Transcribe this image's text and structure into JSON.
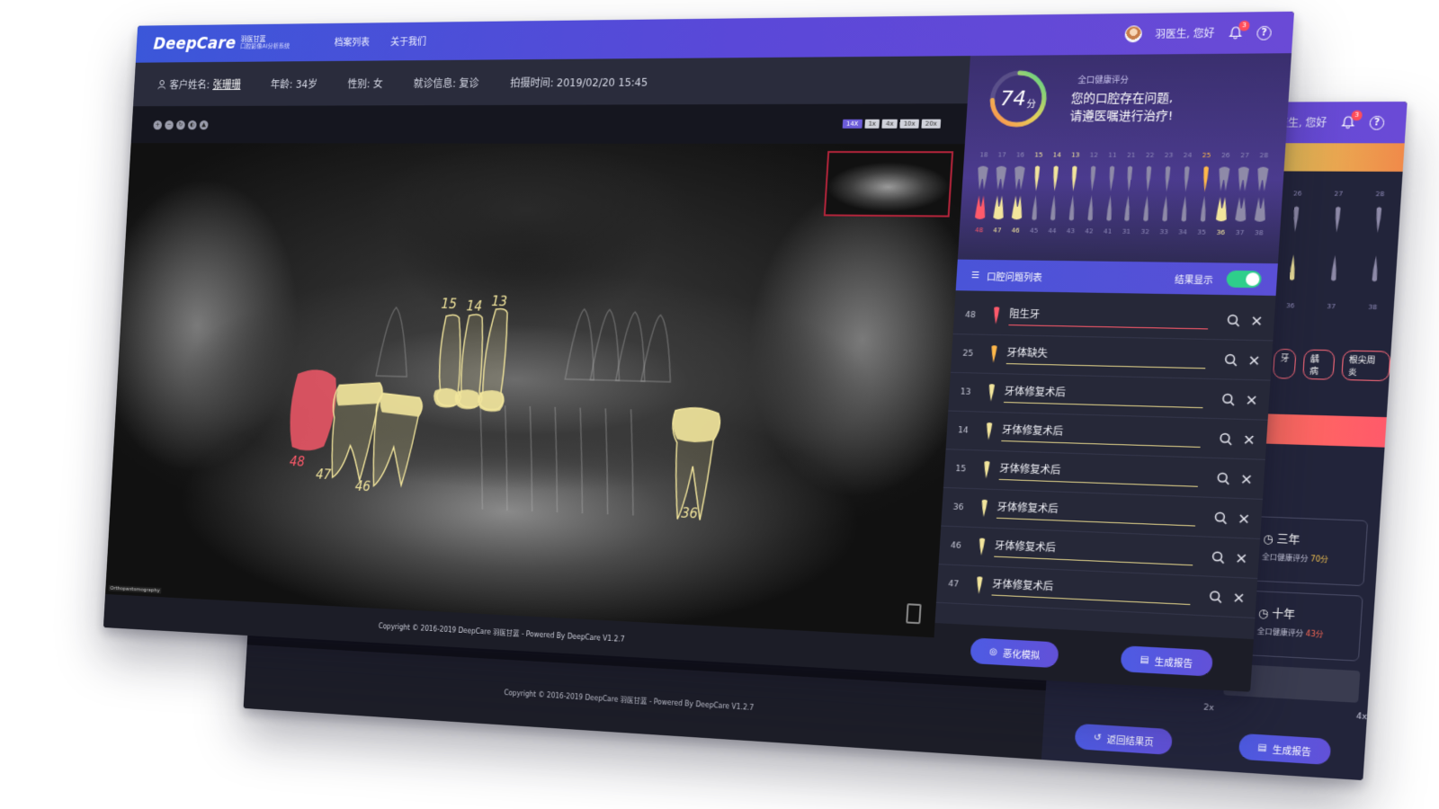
{
  "app": {
    "brand": "DeepCare",
    "brand_sub_1": "羽医甘蓝",
    "brand_sub_2": "口腔影像AI分析系统",
    "nav": [
      "档案列表",
      "关于我们"
    ],
    "greeting": "羽医生, 您好",
    "bell_count": "3",
    "help_glyph": "?"
  },
  "patient": {
    "name_label": "客户姓名:",
    "name": "张珊珊",
    "age": "年龄: 34岁",
    "gender": "性别: 女",
    "visit": "就诊信息: 复诊",
    "time": "拍摄时间: 2019/02/20 15:45"
  },
  "viewer": {
    "tool_icons": [
      "zoom-in-icon",
      "zoom-out-icon",
      "rotate-icon",
      "contrast-icon",
      "brightness-icon"
    ],
    "zoom_levels": [
      "14X",
      "1x",
      "4x",
      "10x",
      "20x"
    ],
    "active_zoom": "14X",
    "film_label": "Orthopantomography",
    "tooth_labels": [
      "15",
      "14",
      "13",
      "48",
      "47",
      "46",
      "36"
    ]
  },
  "footer": {
    "copyright": "Copyright © 2016-2019 DeepCare 羽医甘蓝 - Powered By DeepCare V1.2.7"
  },
  "health": {
    "score": "74",
    "unit": "分",
    "score_fraction": 0.74,
    "title": "全口健康评分",
    "message_1": "您的口腔存在问题,",
    "message_2": "请遵医嘱进行治疗!",
    "upper_teeth": [
      "18",
      "17",
      "16",
      "15",
      "14",
      "13",
      "12",
      "11",
      "21",
      "22",
      "23",
      "24",
      "25",
      "26",
      "27",
      "28"
    ],
    "lower_teeth": [
      "48",
      "47",
      "46",
      "45",
      "44",
      "43",
      "42",
      "41",
      "31",
      "32",
      "33",
      "34",
      "35",
      "36",
      "37",
      "38"
    ]
  },
  "issues": {
    "header": "口腔问题列表",
    "result_toggle_label": "结果显示",
    "toggle_on": true,
    "items": [
      {
        "tooth": "48",
        "label": "阻生牙",
        "severity": "red"
      },
      {
        "tooth": "25",
        "label": "牙体缺失",
        "severity": "orange"
      },
      {
        "tooth": "13",
        "label": "牙体修复术后",
        "severity": "yellow"
      },
      {
        "tooth": "14",
        "label": "牙体修复术后",
        "severity": "yellow"
      },
      {
        "tooth": "15",
        "label": "牙体修复术后",
        "severity": "yellow"
      },
      {
        "tooth": "36",
        "label": "牙体修复术后",
        "severity": "yellow"
      },
      {
        "tooth": "46",
        "label": "牙体修复术后",
        "severity": "yellow"
      },
      {
        "tooth": "47",
        "label": "牙体修复术后",
        "severity": "yellow"
      }
    ]
  },
  "actions": {
    "simulate": "恶化模拟",
    "report": "生成报告",
    "back": "返回结果页"
  },
  "back_screen": {
    "greeting": "羽医生, 您好",
    "bell_count": "3",
    "tags": [
      "牙",
      "龋病",
      "根尖周炎"
    ],
    "projections": [
      {
        "period": "三年",
        "label": "全口健康评分",
        "score": "70分"
      },
      {
        "period": "十年",
        "label": "全口健康评分",
        "score": "43分"
      }
    ],
    "speeds": [
      "2x",
      "4x"
    ],
    "lower_nums_visible": [
      "31",
      "32",
      "33",
      "34",
      "35",
      "36",
      "37",
      "38"
    ],
    "upper_nums_visible": [
      "21",
      "22",
      "23",
      "24",
      "25",
      "26",
      "27",
      "28"
    ]
  },
  "colors": {
    "header_start": "#3b57d9",
    "header_end": "#6a4ad6",
    "restoration": "#f2e59c",
    "impacted": "#ff5a6b",
    "missing": "#ffb84a",
    "toggle": "#2ecf8b"
  }
}
